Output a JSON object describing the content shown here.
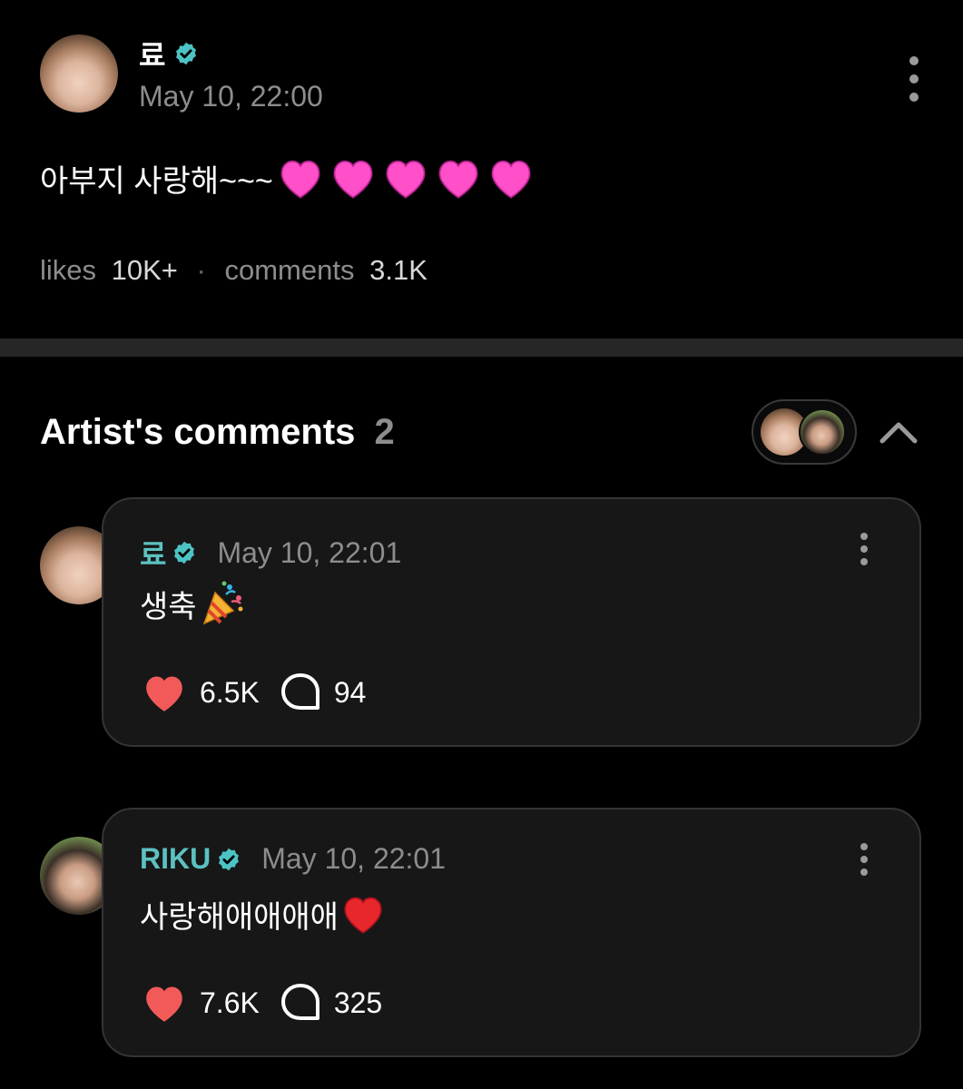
{
  "post": {
    "author": "료",
    "timestamp": "May 10, 22:00",
    "text": "아부지 사랑해~~~",
    "likes_label": "likes",
    "likes_value": "10K+",
    "comments_label": "comments",
    "comments_value": "3.1K"
  },
  "artist_comments": {
    "title": "Artist's comments",
    "count": "2"
  },
  "comments": [
    {
      "author": "료",
      "timestamp": "May 10, 22:01",
      "text": "생축",
      "likes": "6.5K",
      "replies": "94"
    },
    {
      "author": "RIKU",
      "timestamp": "May 10, 22:01",
      "text": "사랑해애애애애",
      "likes": "7.6K",
      "replies": "325"
    }
  ],
  "colors": {
    "background": "#000000",
    "card": "#171717",
    "verified_badge": "#4cc3c4",
    "artist_name": "#5cc1c0",
    "heart": "#f25a5a",
    "pink_heart": "#ff4fc9",
    "muted_text": "#8d8d8d"
  },
  "icons": {
    "verified": "verified-badge-icon",
    "more": "more-vertical-icon",
    "heart": "heart-icon",
    "reply": "speech-bubble-icon",
    "collapse": "chevron-up-icon",
    "party": "party-popper-icon"
  }
}
